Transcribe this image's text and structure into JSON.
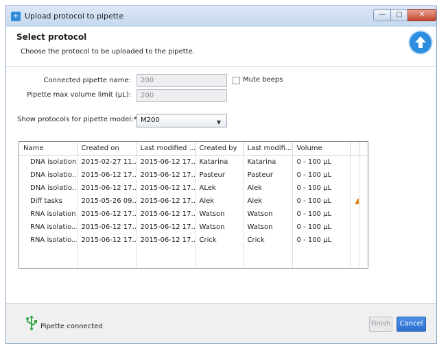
{
  "window": {
    "title": "Upload protocol to pipette",
    "minimize_label": "—",
    "maximize_label": "□",
    "close_label": "✕"
  },
  "header": {
    "title": "Select protocol",
    "subtitle": "Choose the protocol to be uploaded to the pipette.",
    "icon": "upload-arrow-icon"
  },
  "form": {
    "pipette_name_label": "Connected pipette name:",
    "pipette_name_value": "200",
    "mute_beeps_label": "Mute beeps",
    "mute_beeps_checked": false,
    "max_volume_label": "Pipette max volume limit (µL):",
    "max_volume_value": "200",
    "model_label": "Show protocols for pipette model:*",
    "model_value": "M200"
  },
  "table": {
    "columns": [
      "Name",
      "Created on",
      "Last modified ...",
      "Created by",
      "Last modifi...",
      "Volume"
    ],
    "rows": [
      [
        "DNA isolation",
        "2015-02-27 11...",
        "2015-06-12 17...",
        "Katarina",
        "Katarina",
        "0 - 100 µL",
        ""
      ],
      [
        "DNA isolatio...",
        "2015-06-12 17...",
        "2015-06-12 17...",
        "Pasteur",
        "Pasteur",
        "0 - 100 µL",
        ""
      ],
      [
        "DNA isolatio...",
        "2015-06-12 17...",
        "2015-06-12 17...",
        "ALek",
        "Alek",
        "0 - 100 µL",
        ""
      ],
      [
        "Diff tasks",
        "2015-05-26 09...",
        "2015-06-12 17...",
        "Alek",
        "Alek",
        "0 - 100 µL",
        "warning"
      ],
      [
        "RNA isolation",
        "2015-06-12 17...",
        "2015-06-12 17...",
        "Watson",
        "Watson",
        "0 - 100 µL",
        ""
      ],
      [
        "RNA isolatio...",
        "2015-06-12 17...",
        "2015-06-12 17...",
        "Watson",
        "Watson",
        "0 - 100 µL",
        ""
      ],
      [
        "RNA isolatio...",
        "2015-06-12 17...",
        "2015-06-12 17...",
        "Crick",
        "Crick",
        "0 - 100 µL",
        ""
      ]
    ]
  },
  "footer": {
    "status_text": "Pipette connected",
    "status_icon": "usb-icon",
    "finish_label": "Finish",
    "cancel_label": "Cancel"
  },
  "colors": {
    "accent": "#2f6fd2",
    "warning": "#e08417",
    "usb": "#3aa64a"
  }
}
